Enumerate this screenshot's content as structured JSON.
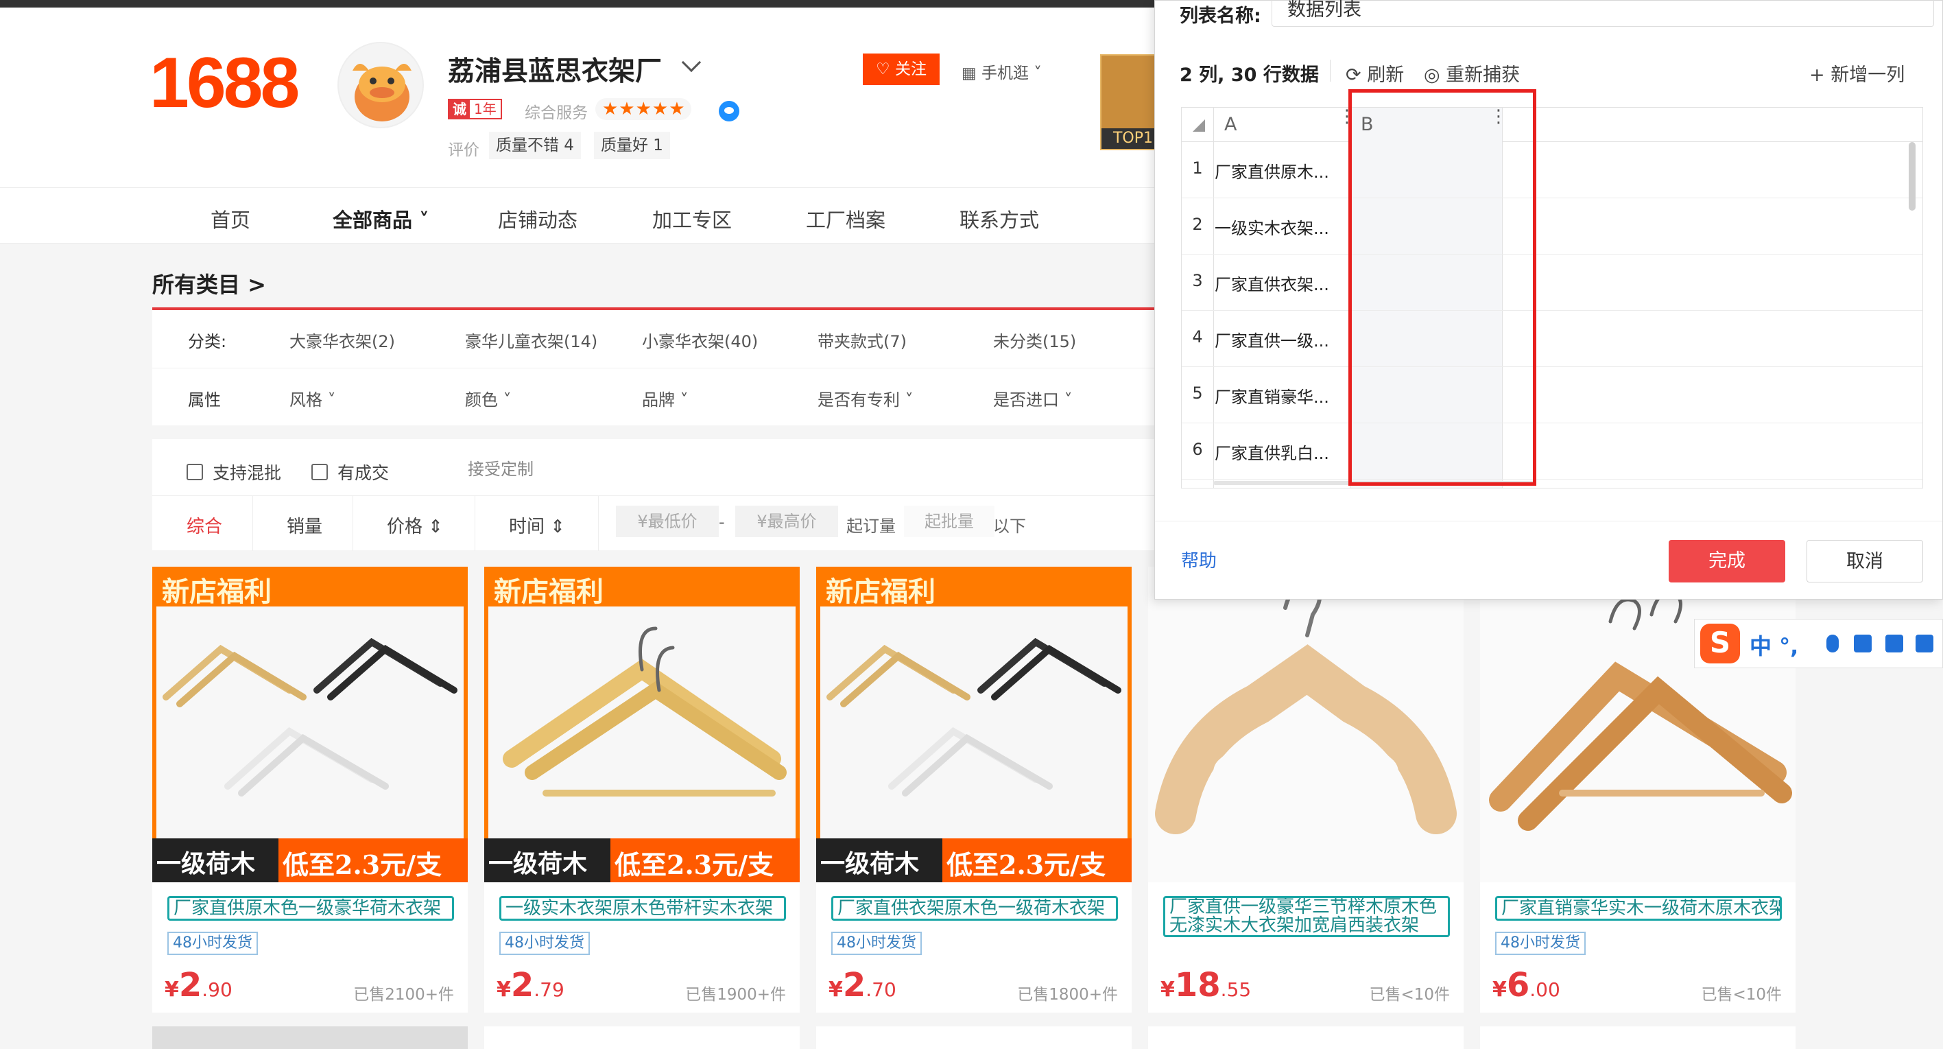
{
  "header": {
    "logo": "1688",
    "shop_name": "荔浦县蓝思衣架厂",
    "cheng_badge": "诚",
    "cheng_years": "1年",
    "service_label": "综合服务",
    "stars": "★★★★★",
    "eval_label": "评价",
    "eval_tags": [
      "质量不错 4",
      "质量好 1"
    ],
    "follow": "♡ 关注",
    "mobile": "▦ 手机逛 ˅",
    "promo_top": "TOP1"
  },
  "nav": {
    "items": [
      "首页",
      "全部商品 ˅",
      "店铺动态",
      "加工专区",
      "工厂档案",
      "联系方式"
    ]
  },
  "category": {
    "title": "所有类目 >",
    "class_label": "分类:",
    "classes": [
      "大豪华衣架(2)",
      "豪华儿童衣架(14)",
      "小豪华衣架(40)",
      "带夹款式(7)",
      "未分类(15)"
    ],
    "attr_label": "属性",
    "attrs": [
      "风格 ˅",
      "颜色 ˅",
      "品牌 ˅",
      "是否有专利 ˅",
      "是否进口 ˅"
    ]
  },
  "sortbar": {
    "chk_mix": "支持混批",
    "chk_deal": "有成交",
    "custom": "接受定制",
    "sorts": [
      "综合",
      "销量",
      "价格 ⇕",
      "时间 ⇕"
    ],
    "min_price": "¥最低价",
    "dash": "-",
    "max_price": "¥最高价",
    "moq_label": "起订量",
    "moq_input": "起批量",
    "below": "以下"
  },
  "banner": {
    "top": "新店福利",
    "left": "一级荷木",
    "right": "低至2.3元/支"
  },
  "products": [
    {
      "title": "厂家直供原木色一级豪华荷木衣架",
      "ship": "48小时发货",
      "cur": "¥",
      "int": "2",
      "dec": ".90",
      "sold": "已售2100+件"
    },
    {
      "title": "一级实木衣架原木色带杆实木衣架",
      "ship": "48小时发货",
      "cur": "¥",
      "int": "2",
      "dec": ".79",
      "sold": "已售1900+件"
    },
    {
      "title": "厂家直供衣架原木色一级荷木衣架",
      "ship": "48小时发货",
      "cur": "¥",
      "int": "2",
      "dec": ".70",
      "sold": "已售1800+件"
    },
    {
      "title": "厂家直供一级豪华三节榉木原木色无漆实木大衣架加宽肩西装衣架",
      "ship": "",
      "cur": "¥",
      "int": "18",
      "dec": ".55",
      "sold": "已售<10件"
    },
    {
      "title": "厂家直销豪华实木一级荷木原木衣架",
      "ship": "48小时发货",
      "cur": "¥",
      "int": "6",
      "dec": ".00",
      "sold": "已售<10件"
    }
  ],
  "modal": {
    "name_label": "列表名称:",
    "name_value": "数据列表",
    "stats": "2 列,  30 行数据",
    "refresh": "⟳ 刷新",
    "recapture": "◎ 重新捕获",
    "add_col": "+ 新增一列",
    "col_a": "A",
    "col_b": "B",
    "col_menu": "⋮",
    "rows": [
      {
        "n": "1",
        "a": "厂家直供原木..."
      },
      {
        "n": "2",
        "a": "一级实木衣架..."
      },
      {
        "n": "3",
        "a": "厂家直供衣架..."
      },
      {
        "n": "4",
        "a": "厂家直供一级..."
      },
      {
        "n": "5",
        "a": "厂家直销豪华..."
      },
      {
        "n": "6",
        "a": "厂家直供乳白..."
      }
    ],
    "help": "帮助",
    "done": "完成",
    "cancel": "取消"
  },
  "ime": {
    "logo": "S",
    "zh": "中 °,",
    "icons": [
      "mic-icon",
      "keyboard-icon",
      "shirt-icon",
      "gamepad-icon"
    ]
  }
}
